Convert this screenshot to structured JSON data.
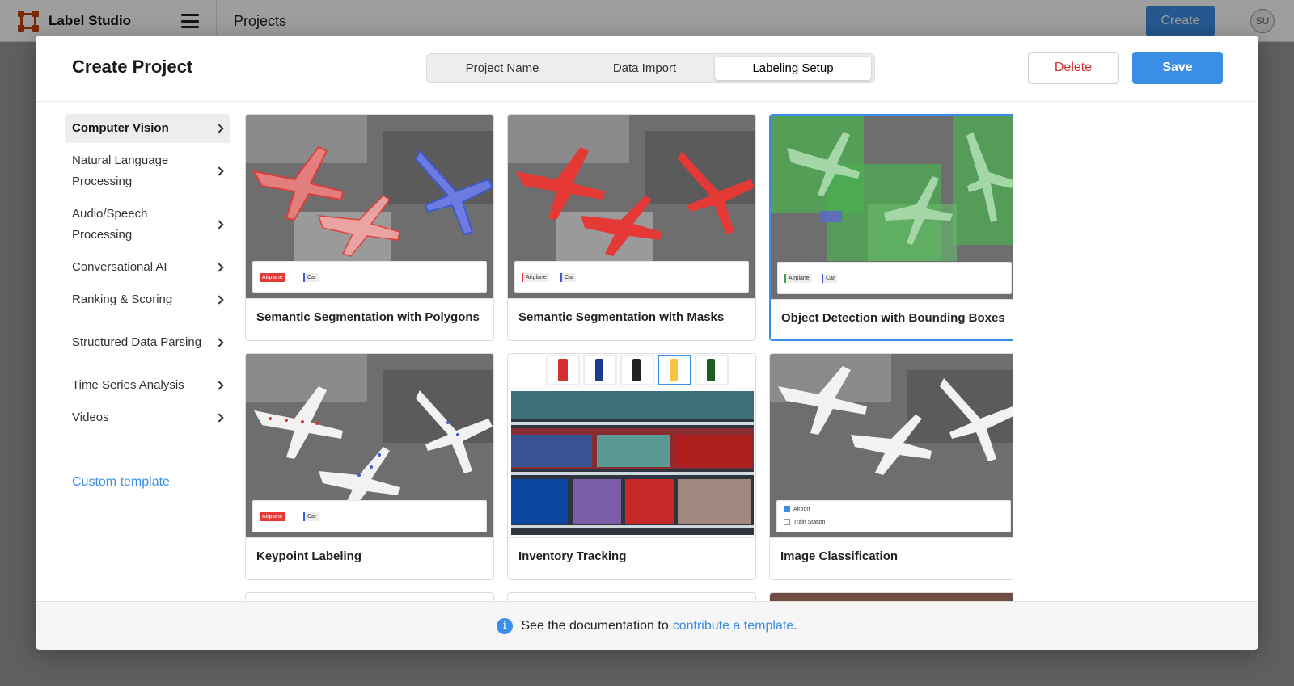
{
  "app": {
    "name": "Label Studio",
    "page_title": "Projects",
    "create_label": "Create",
    "avatar_initials": "SU"
  },
  "modal": {
    "title": "Create Project",
    "tabs": [
      {
        "label": "Project Name",
        "active": false
      },
      {
        "label": "Data Import",
        "active": false
      },
      {
        "label": "Labeling Setup",
        "active": true
      }
    ],
    "delete_label": "Delete",
    "save_label": "Save"
  },
  "sidebar": {
    "items": [
      {
        "label": "Computer Vision",
        "active": true
      },
      {
        "label": "Natural Language Processing",
        "active": false
      },
      {
        "label": "Audio/Speech Processing",
        "active": false
      },
      {
        "label": "Conversational AI",
        "active": false
      },
      {
        "label": "Ranking & Scoring",
        "active": false
      },
      {
        "label": "Structured Data Parsing",
        "active": false
      },
      {
        "label": "Time Series Analysis",
        "active": false
      },
      {
        "label": "Videos",
        "active": false
      }
    ],
    "custom_template": "Custom template"
  },
  "templates": [
    {
      "title": "Semantic Segmentation with Polygons",
      "selected": false,
      "labels": [
        "Airplane",
        "Car"
      ]
    },
    {
      "title": "Semantic Segmentation with Masks",
      "selected": false,
      "labels": [
        "Airplane",
        "Car"
      ]
    },
    {
      "title": "Object Detection with Bounding Boxes",
      "selected": true,
      "labels": [
        "Airplane",
        "Car"
      ]
    },
    {
      "title": "Keypoint Labeling",
      "selected": false,
      "labels": [
        "Airplane",
        "Car"
      ]
    },
    {
      "title": "Inventory Tracking",
      "selected": false
    },
    {
      "title": "Image Classification",
      "selected": false,
      "choices": [
        "Airport",
        "Train Station"
      ]
    }
  ],
  "footer": {
    "text": "See the documentation to",
    "link": "contribute a template",
    "suffix": "."
  },
  "colors": {
    "accent": "#3b8ee6",
    "danger": "#d32f2f",
    "airplane": "#e53935",
    "car": "#3b5bd6",
    "bbox": "#43a047"
  }
}
